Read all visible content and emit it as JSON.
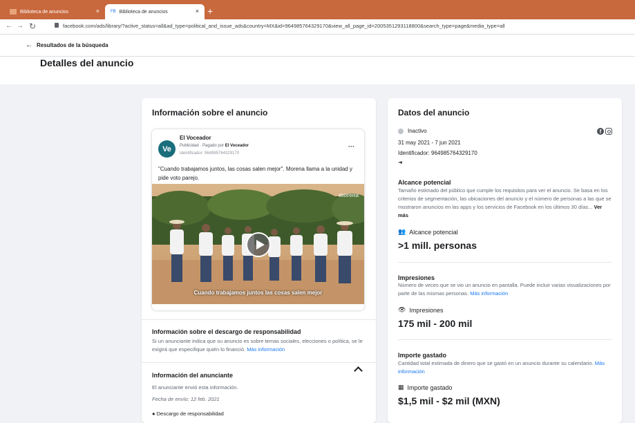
{
  "browser": {
    "tabs": [
      {
        "label": "Biblioteca de anuncios",
        "close": "×"
      },
      {
        "icon": "FB",
        "label": "Biblioteca de anuncios",
        "close": "×"
      }
    ],
    "new_tab": "+",
    "url": "facebook.com/ads/library/?active_status=all&ad_type=political_and_issue_ads&country=MX&id=964985764329170&view_all_page_id=2005351293118800&search_type=page&media_type=all"
  },
  "topbar": {
    "back_label": "Resultados de la búsqueda"
  },
  "page_title": "Detalles del anuncio",
  "ad_info": {
    "title": "Información sobre el anuncio",
    "preview": {
      "avatar_text": "Ve",
      "page_name": "El Voceador",
      "sub_prefix": "Publicidad · Pagado por",
      "sub_payer": "El Voceador",
      "id_line": "Identificador: 964985764329170",
      "text": "\"Cuando trabajamos juntos, las cosas salen mejor\". Morena llama a la unidad y pide voto parejo.",
      "watermark": "morena",
      "caption": "Cuando trabajamos juntos las cosas salen mejor"
    },
    "disclaimer": {
      "title": "Información sobre el descargo de responsabilidad",
      "desc": "Si un anunciante indica que su anuncio es sobre temas sociales, elecciones o política, se le exigirá que especifique quién lo financió.",
      "link": "Más información"
    },
    "advertiser": {
      "title": "Información del anunciante",
      "sent": "El anunciante envió esta información.",
      "date": "Fecha de envío: 12 feb. 2021",
      "cut_item": "Descargo de responsabilidad"
    }
  },
  "ad_data": {
    "title": "Datos del anuncio",
    "status": "Inactivo",
    "dates": "31 may 2021 - 7 jun 2021",
    "id": "Identificador: 964985764329170",
    "reach": {
      "title": "Alcance potencial",
      "desc": "Tamaño estimado del público que cumple los requisitos para ver el anuncio. Se basa en los criterios de segmentación, las ubicaciones del anuncio y el número de personas a las que se mostraron anuncios en las apps y los servicios de Facebook en los últimos 30 días...",
      "more": "Ver más",
      "label": "Alcance potencial",
      "value": ">1 mill. personas"
    },
    "impressions": {
      "title": "Impresiones",
      "desc": "Número de veces que se vio un anuncio en pantalla. Puede incluir varias visualizaciones por parte de las mismas personas.",
      "link": "Más información",
      "label": "Impresiones",
      "value": "175 mil - 200 mil"
    },
    "spend": {
      "title": "Importe gastado",
      "desc": "Cantidad total estimada de dinero que se gastó en un anuncio durante su calendario.",
      "link": "Más información",
      "label": "Importe gastado",
      "value": "$1,5 mil - $2 mil (MXN)"
    }
  }
}
